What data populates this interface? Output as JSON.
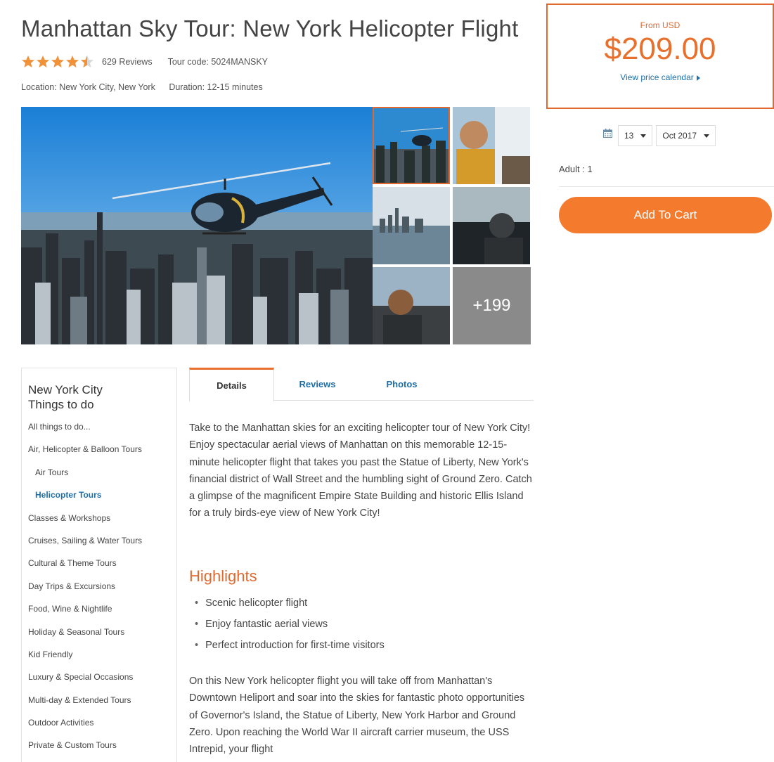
{
  "header": {
    "title": "Manhattan Sky Tour: New York Helicopter Flight",
    "rating": 4.5,
    "reviews": "629 Reviews",
    "tour_code": "Tour code:  5024MANSKY",
    "location": "Location:  New York City, New York",
    "duration": "Duration:  12-15 minutes"
  },
  "gallery": {
    "more_label": "+199"
  },
  "booking": {
    "from_label": "From USD",
    "price": "$209.00",
    "calendar_link": "View price calendar",
    "day": "13",
    "month": "Oct 2017",
    "adult": "Adult : 1",
    "add_to_cart": "Add To Cart"
  },
  "sidebar": {
    "title": "New York City Things to do",
    "items": [
      {
        "label": "All things to do..."
      },
      {
        "label": "Air, Helicopter & Balloon Tours"
      },
      {
        "label": "Air Tours"
      },
      {
        "label": "Helicopter Tours"
      },
      {
        "label": "Classes & Workshops"
      },
      {
        "label": "Cruises, Sailing & Water Tours"
      },
      {
        "label": "Cultural & Theme Tours"
      },
      {
        "label": "Day Trips & Excursions"
      },
      {
        "label": "Food, Wine & Nightlife"
      },
      {
        "label": "Holiday & Seasonal Tours"
      },
      {
        "label": "Kid Friendly"
      },
      {
        "label": "Luxury & Special Occasions"
      },
      {
        "label": "Multi-day & Extended Tours"
      },
      {
        "label": "Outdoor Activities"
      },
      {
        "label": "Private & Custom Tours"
      }
    ]
  },
  "tabs": [
    {
      "label": "Details"
    },
    {
      "label": "Reviews"
    },
    {
      "label": "Photos"
    }
  ],
  "content": {
    "description": "Take to the Manhattan skies for an exciting helicopter tour of New York City! Enjoy spectacular aerial views of Manhattan on this memorable 12-15-minute helicopter flight that takes you past the Statue of Liberty, New York's financial district of Wall Street and the humbling sight of Ground Zero. Catch a glimpse of the magnificent Empire State Building and historic Ellis Island for a truly birds-eye view of New York City!",
    "highlights_title": "Highlights",
    "highlights": [
      "Scenic helicopter flight",
      "Enjoy fantastic aerial views",
      "Perfect introduction for first-time visitors"
    ],
    "description2": "On this New York helicopter flight you will take off from Manhattan's Downtown Heliport and soar into the skies for fantastic photo opportunities of Governor's Island, the Statue of Liberty, New York Harbor and Ground Zero. Upon reaching the World War II aircraft carrier museum, the USS Intrepid, your flight"
  },
  "colors": {
    "accent": "#e8702c",
    "link": "#1e6fa8",
    "star": "#f0923a"
  }
}
